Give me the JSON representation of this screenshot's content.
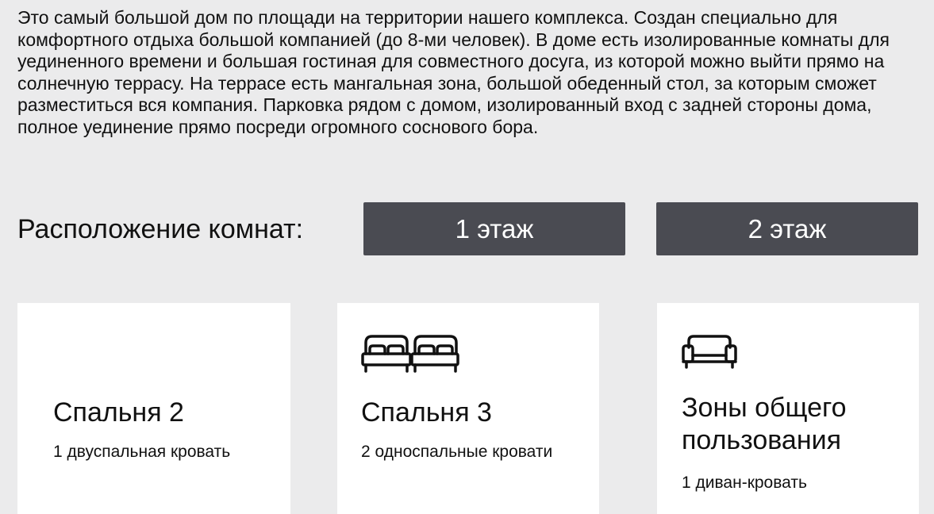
{
  "description": "Это самый большой дом по площади на территории нашего комплекса. Создан специально для комфортного отдыха большой компанией (до 8-ми человек). В доме есть изолированные комнаты для уединенного времени и большая гостиная для совместного досуга, из которой можно выйти прямо на солнечную террасу. На террасе есть мангальная зона, большой обеденный стол, за которым сможет разместиться вся компания. Парковка рядом с домом, изолированный вход с задней стороны дома, полное уединение прямо посреди огромного соснового бора.",
  "rooms_layout": {
    "label": "Расположение комнат:",
    "floors": [
      {
        "label": "1 этаж"
      },
      {
        "label": "2 этаж"
      }
    ]
  },
  "rooms": [
    {
      "title": "Спальня 2",
      "beds": "1 двуспальная кровать",
      "icon": "none"
    },
    {
      "title": "Спальня 3",
      "beds": "2 односпальные кровати",
      "icon": "two-beds-icon"
    },
    {
      "title": "Зоны общего пользования",
      "beds": "1 диван-кровать",
      "icon": "sofa-icon"
    }
  ],
  "colors": {
    "background": "#ebebec",
    "button": "#4a4b52",
    "card": "#ffffff",
    "text": "#111111"
  }
}
